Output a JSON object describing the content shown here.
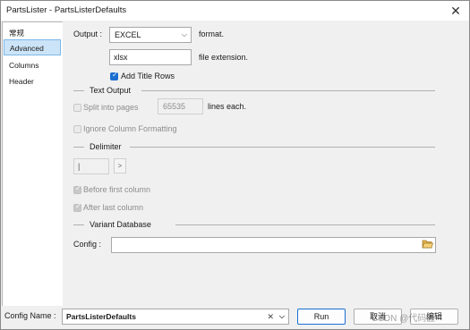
{
  "window": {
    "title": "PartsLister - PartsListerDefaults",
    "close_label": "✕"
  },
  "nav": {
    "items": [
      "常规",
      "Advanced",
      "Columns",
      "Header"
    ],
    "active": "Advanced"
  },
  "output": {
    "label": "Output :",
    "format_value": "EXCEL",
    "format_suffix": "format.",
    "extension_value": "xlsx",
    "extension_suffix": "file extension.",
    "add_title_rows_label": "Add Title Rows",
    "add_title_rows_checked": true
  },
  "text_output": {
    "heading": "Text Output",
    "split_label": "Split into pages",
    "split_checked": false,
    "lines_value": "65535",
    "lines_suffix": "lines each.",
    "ignore_formatting_label": "Ignore Column Formatting",
    "ignore_formatting_checked": false
  },
  "delimiter": {
    "heading": "Delimiter",
    "value": "|",
    "button_label": ">",
    "before_first_label": "Before first column",
    "before_first_checked": true,
    "after_last_label": "After last column",
    "after_last_checked": true
  },
  "variant_db": {
    "heading": "Variant Database",
    "config_label": "Config :",
    "config_value": ""
  },
  "bottom": {
    "config_name_label": "Config Name :",
    "config_name_value": "PartsListerDefaults",
    "clear_symbol": "✕",
    "run_label": "Run",
    "cancel_label": "取消",
    "apply_label": "编辑"
  },
  "watermark": "CSDN @代码匠"
}
